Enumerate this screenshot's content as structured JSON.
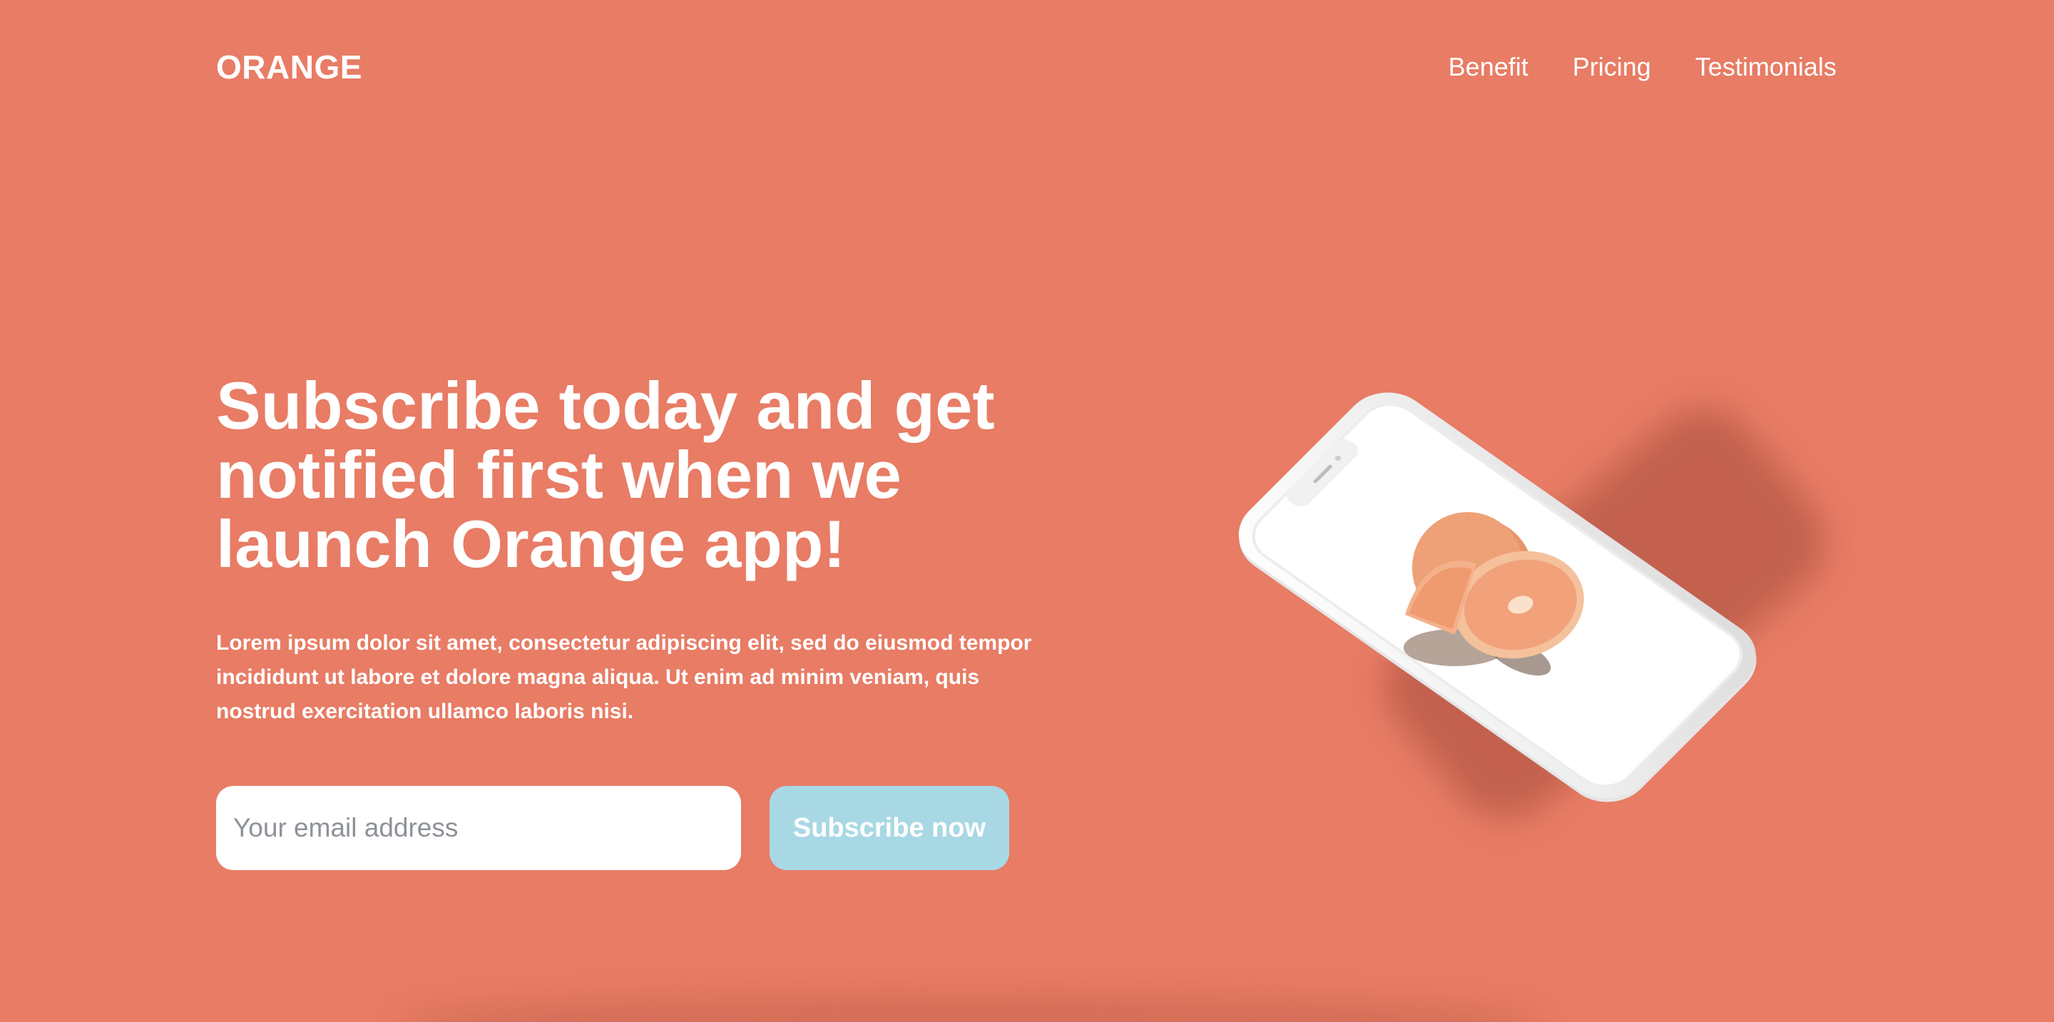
{
  "header": {
    "logo": "ORANGE",
    "nav": [
      "Benefit",
      "Pricing",
      "Testimonials"
    ]
  },
  "hero": {
    "headline": "Subscribe today and get notified first when we launch Orange app!",
    "description": "Lorem ipsum dolor sit amet, consectetur adipiscing elit, sed do eiusmod tempor incididunt ut labore et dolore magna aliqua. Ut enim ad minim veniam, quis nostrud exercitation ullamco laboris nisi.",
    "email_placeholder": "Your email address",
    "email_value": "",
    "subscribe_label": "Subscribe now"
  },
  "colors": {
    "background": "#e87c65",
    "button": "#a8d8e4",
    "text": "#ffffff"
  },
  "images": {
    "phone": "phone-mockup-with-orange"
  }
}
